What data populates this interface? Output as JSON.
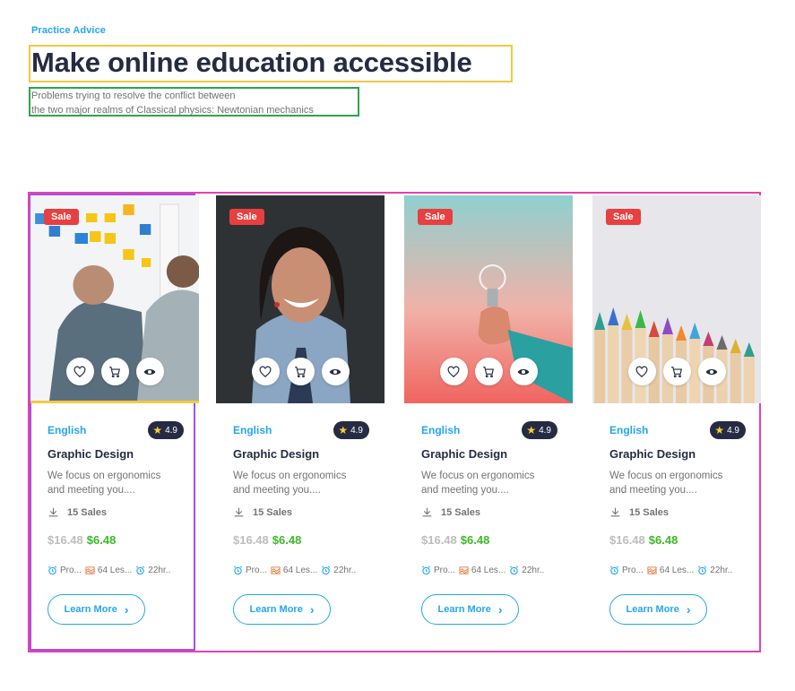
{
  "header": {
    "eyebrow": "Practice Advice",
    "title": "Make online education accessible",
    "subtitle_line1": "Problems trying to resolve the conflict between",
    "subtitle_line2": "the two major realms of Classical physics: Newtonian mechanics"
  },
  "products": [
    {
      "sale": "Sale",
      "category": "English",
      "rating": "4.9",
      "title": "Graphic Design",
      "desc_line1": "We focus on ergonomics",
      "desc_line2": "and meeting you....",
      "sales": "15 Sales",
      "old_price": "$16.48",
      "new_price": "$6.48",
      "meta1": "Pro...",
      "meta2": "64 Les...",
      "meta3": "22hr..",
      "cta": "Learn More",
      "image": "whiteboard-meeting"
    },
    {
      "sale": "Sale",
      "category": "English",
      "rating": "4.9",
      "title": "Graphic Design",
      "desc_line1": "We focus on ergonomics",
      "desc_line2": "and meeting you....",
      "sales": "15 Sales",
      "old_price": "$16.48",
      "new_price": "$6.48",
      "meta1": "Pro...",
      "meta2": "64 Les...",
      "meta3": "22hr..",
      "cta": "Learn More",
      "image": "smiling-woman"
    },
    {
      "sale": "Sale",
      "category": "English",
      "rating": "4.9",
      "title": "Graphic Design",
      "desc_line1": "We focus on ergonomics",
      "desc_line2": "and meeting you....",
      "sales": "15 Sales",
      "old_price": "$16.48",
      "new_price": "$6.48",
      "meta1": "Pro...",
      "meta2": "64 Les...",
      "meta3": "22hr..",
      "cta": "Learn More",
      "image": "hand-lightbulb"
    },
    {
      "sale": "Sale",
      "category": "English",
      "rating": "4.9",
      "title": "Graphic Design",
      "desc_line1": "We focus on ergonomics",
      "desc_line2": "and meeting you....",
      "sales": "15 Sales",
      "old_price": "$16.48",
      "new_price": "$6.48",
      "meta1": "Pro...",
      "meta2": "64 Les...",
      "meta3": "22hr..",
      "cta": "Learn More",
      "image": "colored-pencils"
    }
  ],
  "colors": {
    "primary": "#23a6f0",
    "sale": "#e74040",
    "price_new": "#3cb928",
    "price_old": "#bdbdbd",
    "heading": "#252b42",
    "muted": "#737373"
  },
  "icons": [
    "heart-icon",
    "cart-icon",
    "eye-icon",
    "download-icon",
    "alarm-icon",
    "chart-icon",
    "chevron-right-icon",
    "star-icon"
  ]
}
